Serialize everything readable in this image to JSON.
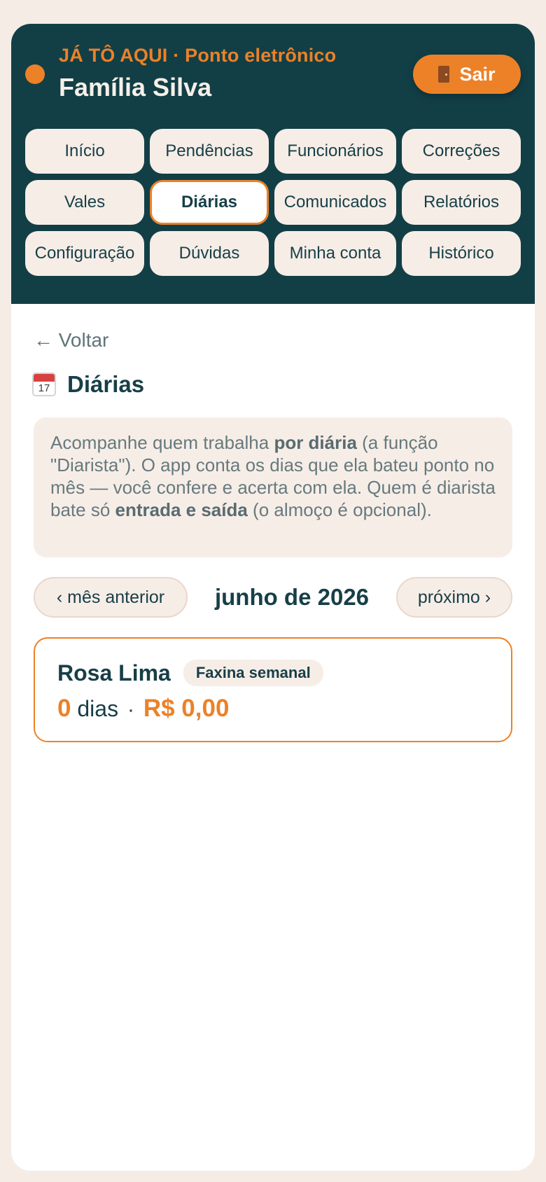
{
  "header": {
    "brand": "JÁ TÔ AQUI · Ponto eletrônico",
    "family_name": "Família Silva",
    "logout_label": "Sair",
    "logout_icon": "door-icon"
  },
  "nav": {
    "items": [
      {
        "label": "Início"
      },
      {
        "label": "Pendências"
      },
      {
        "label": "Funcionários"
      },
      {
        "label": "Correções"
      },
      {
        "label": "Vales"
      },
      {
        "label": "Diárias"
      },
      {
        "label": "Comunicados"
      },
      {
        "label": "Relatórios"
      },
      {
        "label": "Configuração"
      },
      {
        "label": "Dúvidas"
      },
      {
        "label": "Minha conta"
      },
      {
        "label": "Histórico"
      }
    ],
    "active": "Diárias"
  },
  "page": {
    "back_label": "← Voltar",
    "title": "Diárias",
    "title_icon": "calendar-icon",
    "calendar_day": "17"
  },
  "info": {
    "part1": "Acompanhe quem trabalha ",
    "bold1": "por diária",
    "part2": " (a função \"Diarista\"). O app conta os dias que ela bateu ponto no mês — você confere e acerta com ela. Quem é diarista bate só ",
    "bold2": "entrada e saída",
    "part3": " (o almoço é opcional)."
  },
  "month_nav": {
    "prev_label": "‹ mês anterior",
    "current": "junho de 2026",
    "next_label": "próximo ›"
  },
  "workers": [
    {
      "name": "Rosa Lima",
      "tag": "Faxina semanal",
      "days": "0",
      "days_unit": "dias",
      "separator": "·",
      "amount": "R$ 0,00"
    }
  ],
  "colors": {
    "primary_dark": "#123f46",
    "accent": "#ec8128",
    "background": "#f5ece6"
  }
}
